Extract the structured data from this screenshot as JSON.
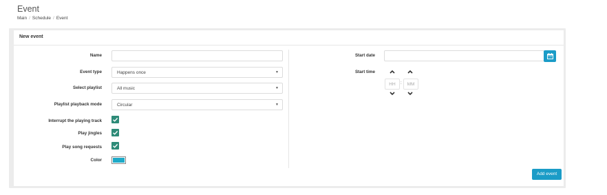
{
  "page": {
    "title": "Event",
    "breadcrumb": [
      "Main",
      "Schedule",
      "Event"
    ]
  },
  "panel": {
    "heading": "New event"
  },
  "form": {
    "name_label": "Name",
    "name_value": "",
    "event_type_label": "Event type",
    "event_type_value": "Happens once",
    "playlist_label": "Select playlist",
    "playlist_value": "All music",
    "playback_mode_label": "Playlist playback mode",
    "playback_mode_value": "Circular",
    "interrupt_label": "Interrupt the playing track",
    "interrupt_checked": true,
    "jingles_label": "Play jingles",
    "jingles_checked": true,
    "song_requests_label": "Play song requests",
    "song_requests_checked": true,
    "color_label": "Color",
    "color_value": "#1eaac8",
    "start_date_label": "Start date",
    "start_date_value": "",
    "start_time_label": "Start time",
    "hour_placeholder": "HH",
    "minute_placeholder": "MM",
    "time_separator": ":"
  },
  "actions": {
    "add_event_label": "Add event"
  },
  "colors": {
    "accent": "#1b9cc7",
    "checkbox": "#2e8b78"
  },
  "icons": {
    "calendar": "calendar-icon",
    "caret": "caret-down-icon",
    "check": "check-icon",
    "chevron_up": "chevron-up-icon",
    "chevron_down": "chevron-down-icon"
  }
}
